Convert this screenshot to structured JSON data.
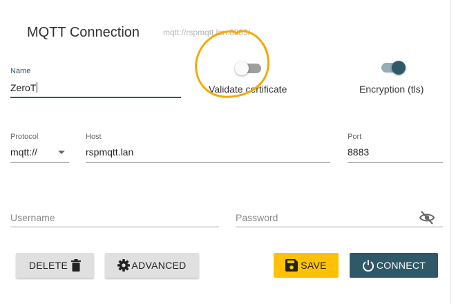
{
  "dialog": {
    "title": "MQTT Connection",
    "subtitle": "mqtt://rspmqtt.lan:8883/"
  },
  "name_field": {
    "label": "Name",
    "value": "ZeroT"
  },
  "validate_toggle": {
    "label": "Validate certificate",
    "on": false
  },
  "encryption_toggle": {
    "label": "Encryption (tls)",
    "on": true
  },
  "protocol_field": {
    "label": "Protocol",
    "value": "mqtt://",
    "options": [
      "mqtt://"
    ]
  },
  "host_field": {
    "label": "Host",
    "value": "rspmqtt.lan"
  },
  "port_field": {
    "label": "Port",
    "value": "8883"
  },
  "username_field": {
    "placeholder": "Username",
    "value": ""
  },
  "password_field": {
    "placeholder": "Password",
    "value": ""
  },
  "buttons": {
    "delete": "DELETE",
    "advanced": "ADVANCED",
    "save": "SAVE",
    "connect": "CONNECT"
  },
  "icons": {
    "delete": "trash-icon",
    "advanced": "gear-icon",
    "save": "floppy-disk-icon",
    "connect": "power-icon",
    "password_visibility": "eye-off-icon",
    "protocol_dropdown": "chevron-down-icon"
  },
  "colors": {
    "primary": "#2f5968",
    "save": "#ffc107",
    "annotation": "#f5a800"
  }
}
